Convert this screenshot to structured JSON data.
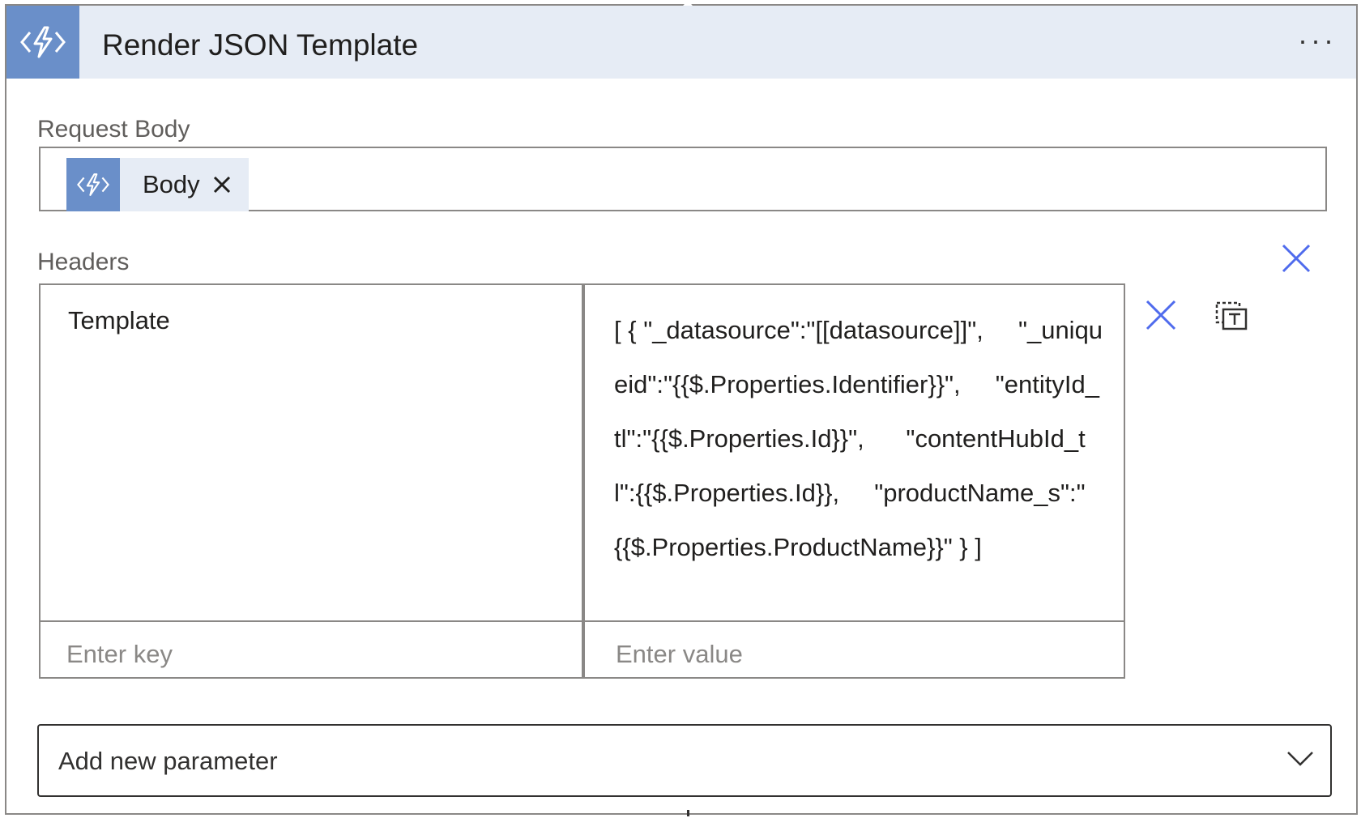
{
  "action": {
    "title": "Render JSON Template",
    "icon": "azure-function-icon",
    "menu_label": "···"
  },
  "request_body": {
    "label": "Request Body",
    "token": {
      "icon": "azure-function-icon",
      "label": "Body"
    }
  },
  "headers": {
    "label": "Headers",
    "rows": [
      {
        "key": "Template",
        "value": "[ { \"_datasource\":\"[[datasource]]\",     \"_uniqueid\":\"{{$.Properties.Identifier}}\",     \"entityId_tl\":\"{{$.Properties.Id}}\",      \"contentHubId_tl\":{{$.Properties.Id}},     \"productName_s\":\"{{$.Properties.ProductName}}\" } ]"
      }
    ],
    "key_placeholder": "Enter key",
    "value_placeholder": "Enter value"
  },
  "add_parameter": {
    "label": "Add new parameter"
  },
  "colors": {
    "accent": "#6a8fc9",
    "header_bg": "#e6ecf5",
    "icon_blue": "#4f6bed"
  }
}
